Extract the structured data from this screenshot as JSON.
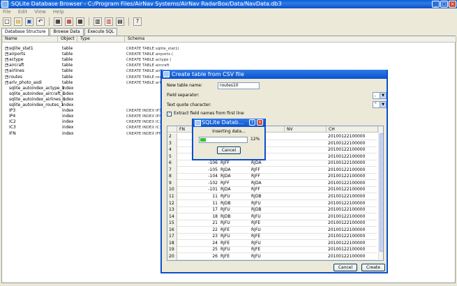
{
  "window": {
    "title": "SQLite Database Browser - C:/Program Files/AirNav Systems/AirNav RadarBox/Data/NavData.db3",
    "min": "_",
    "max": "□",
    "close": "×"
  },
  "menu": [
    "File",
    "Edit",
    "View",
    "Help"
  ],
  "toolbar_icons": [
    "new-db-icon",
    "open-db-icon",
    "save-icon",
    "undo-icon",
    "create-table-icon",
    "delete-table-icon",
    "modify-table-icon",
    "create-index-icon",
    "delete-index-icon",
    "query-icon",
    "whats-this-icon"
  ],
  "tabs": [
    "Database Structure",
    "Browse Data",
    "Execute SQL"
  ],
  "structure": {
    "columns": [
      "Name",
      "Object",
      "Type",
      "Schema"
    ],
    "rows": [
      {
        "exp": "+",
        "name": "sqlite_stat1",
        "object": "table",
        "schema": "CREATE TABLE sqlite_stat1(tbl,idx,stat)"
      },
      {
        "exp": "+",
        "name": "airports",
        "object": "table",
        "schema": "CREATE TABLE airports ("
      },
      {
        "exp": "+",
        "name": "actype",
        "object": "table",
        "schema": "CREATE TABLE actype ("
      },
      {
        "exp": "+",
        "name": "aircraft",
        "object": "table",
        "schema": "CREATE TABLE aircraft"
      },
      {
        "exp": "+",
        "name": "airlines",
        "object": "table",
        "schema": "CREATE TABLE airlines"
      },
      {
        "exp": "+",
        "name": "routes",
        "object": "table",
        "schema": "CREATE TABLE routes"
      },
      {
        "exp": "+",
        "name": "arlv_photo_asdi",
        "object": "table",
        "schema": "CREATE TABLE arlv_pho"
      },
      {
        "exp": "",
        "name": "sqlite_autoindex_actype_1",
        "object": "index",
        "schema": ""
      },
      {
        "exp": "",
        "name": "sqlite_autoindex_aircraft_1",
        "object": "index",
        "schema": ""
      },
      {
        "exp": "",
        "name": "sqlite_autoindex_airlines_1",
        "object": "index",
        "schema": ""
      },
      {
        "exp": "",
        "name": "sqlite_autoindex_routes_1",
        "object": "index",
        "schema": ""
      },
      {
        "exp": "",
        "name": "IP3",
        "object": "index",
        "schema": "CREATE INDEX IP3"
      },
      {
        "exp": "",
        "name": "IP4",
        "object": "index",
        "schema": "CREATE INDEX IP4"
      },
      {
        "exp": "",
        "name": "IC2",
        "object": "index",
        "schema": "CREATE INDEX IC2"
      },
      {
        "exp": "",
        "name": "IC3",
        "object": "index",
        "schema": "CREATE INDEX IC3"
      },
      {
        "exp": "",
        "name": "IFN",
        "object": "index",
        "schema": "CREATE INDEX IFN"
      }
    ]
  },
  "csv_dialog": {
    "title": "Create table from CSV file",
    "table_name_label": "New table name:",
    "table_name_value": "routes10",
    "field_sep_label": "Field separator:",
    "field_sep_value": ",",
    "quote_label": "Text quote character:",
    "quote_value": "\"",
    "extract_label": "Extract field names from first line",
    "grid_columns": [
      "FN",
      "",
      "",
      "NV",
      "CH"
    ],
    "rows": [
      {
        "n": "2",
        "a": "",
        "b": "",
        "c": "",
        "ch": "20100122100000"
      },
      {
        "n": "3",
        "a": "",
        "b": "",
        "c": "",
        "ch": "20100122100000"
      },
      {
        "n": "4",
        "a": "",
        "b": "",
        "c": "",
        "ch": "20100122100000"
      },
      {
        "n": "5",
        "a": "",
        "b": "",
        "c": "",
        "ch": "20100122100000"
      },
      {
        "n": "6",
        "a": "-106",
        "b": "RJFF",
        "c": "RJDA",
        "ch": "20100122100000"
      },
      {
        "n": "7",
        "a": "-105",
        "b": "RJDA",
        "c": "RJFF",
        "ch": "20100122100000"
      },
      {
        "n": "8",
        "a": "-104",
        "b": "RJDA",
        "c": "RJFF",
        "ch": "20100122100000"
      },
      {
        "n": "9",
        "a": "-102",
        "b": "RJFF",
        "c": "RJDA",
        "ch": "20100122100000"
      },
      {
        "n": "10",
        "a": "-101",
        "b": "RJDA",
        "c": "RJFF",
        "ch": "20100122100000"
      },
      {
        "n": "11",
        "a": "11",
        "b": "RJFU",
        "c": "RJDB",
        "ch": "20100122100000"
      },
      {
        "n": "12",
        "a": "11",
        "b": "RJDB",
        "c": "RJFU",
        "ch": "20100122100000"
      },
      {
        "n": "13",
        "a": "17",
        "b": "RJFU",
        "c": "RJDB",
        "ch": "20100122100000"
      },
      {
        "n": "14",
        "a": "18",
        "b": "RJDB",
        "c": "RJFU",
        "ch": "20100122100000"
      },
      {
        "n": "15",
        "a": "21",
        "b": "RJFU",
        "c": "RJFE",
        "ch": "20100122100000"
      },
      {
        "n": "16",
        "a": "22",
        "b": "RJFE",
        "c": "RJFU",
        "ch": "20100122100000"
      },
      {
        "n": "17",
        "a": "23",
        "b": "RJFU",
        "c": "RJFE",
        "ch": "20100122100000"
      },
      {
        "n": "18",
        "a": "24",
        "b": "RJFE",
        "c": "RJFU",
        "ch": "20100122100000"
      },
      {
        "n": "19",
        "a": "25",
        "b": "RJFU",
        "c": "RJFE",
        "ch": "20100122100000"
      },
      {
        "n": "20",
        "a": "26",
        "b": "RJFE",
        "c": "RJFU",
        "ch": "20100122100000"
      }
    ],
    "cancel": "Cancel",
    "create": "Create"
  },
  "progress_dialog": {
    "title": "SQLite Datab...",
    "message": "Inserting data...",
    "percent": "12%",
    "fraction": 0.12,
    "cancel": "Cancel"
  }
}
